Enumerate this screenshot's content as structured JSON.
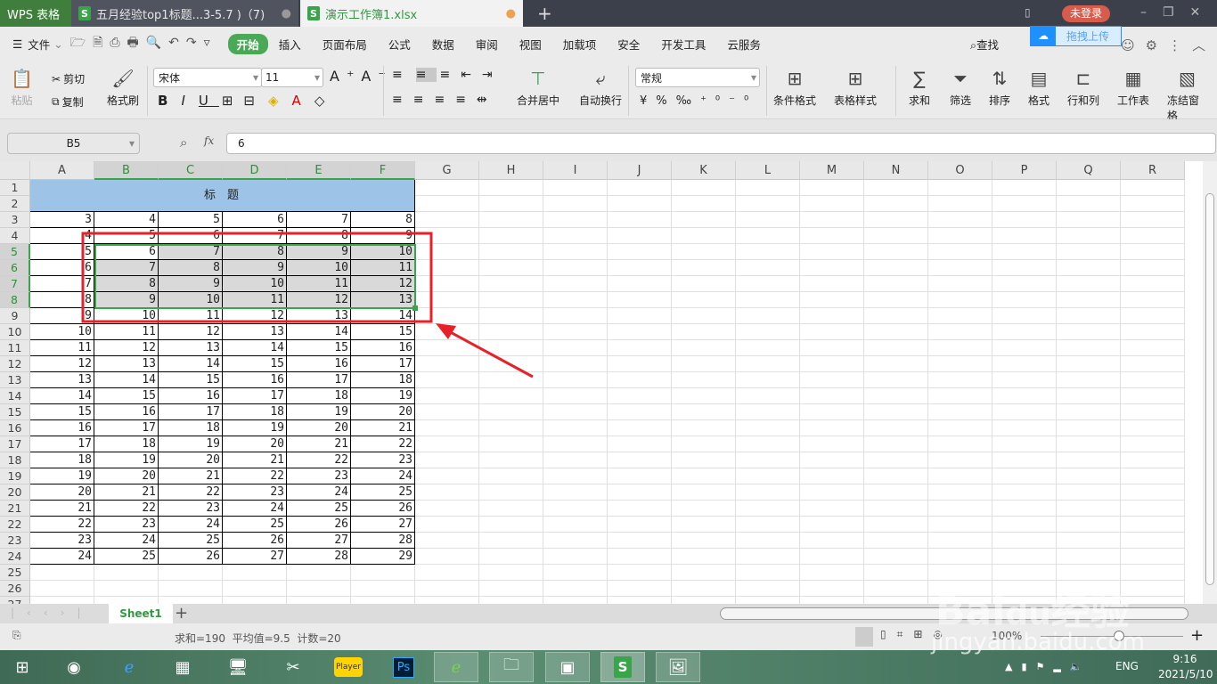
{
  "titlebar": {
    "app_label": "WPS 表格",
    "tabs": [
      {
        "label": "五月经验top1标题...3-5.7 )（7)",
        "active": false
      },
      {
        "label": "演示工作簿1.xlsx",
        "active": true
      }
    ],
    "new_tab": "+",
    "login": "未登录",
    "upload": "拖拽上传"
  },
  "menubar": {
    "file": "文件",
    "items": [
      "开始",
      "插入",
      "页面布局",
      "公式",
      "数据",
      "审阅",
      "视图",
      "加载项",
      "安全",
      "开发工具",
      "云服务"
    ],
    "active": "开始",
    "search": "查找"
  },
  "ribbon": {
    "paste": "粘贴",
    "cut": "剪切",
    "copy": "复制",
    "format_painter": "格式刷",
    "font": "宋体",
    "size": "11",
    "merge": "合并居中",
    "wrap": "自动换行",
    "number_format": "常规",
    "cond_format": "条件格式",
    "table_style": "表格样式",
    "sum": "求和",
    "filter": "筛选",
    "sort": "排序",
    "format": "格式",
    "rowcol": "行和列",
    "sheet": "工作表",
    "freeze": "冻结窗格"
  },
  "formula": {
    "name_box": "B5",
    "fx": "fx",
    "value": "6"
  },
  "grid": {
    "columns": [
      "A",
      "B",
      "C",
      "D",
      "E",
      "F",
      "G",
      "H",
      "I",
      "J",
      "K",
      "L",
      "M",
      "N",
      "O",
      "P",
      "Q",
      "R"
    ],
    "selected_columns": [
      "B",
      "C",
      "D",
      "E",
      "F"
    ],
    "selected_rows": [
      5,
      6,
      7,
      8
    ],
    "row_count": 27,
    "header_text": "标　题",
    "header_color": "#9dc3e6",
    "data": [
      [
        3,
        4,
        5,
        6,
        7,
        8
      ],
      [
        4,
        5,
        6,
        7,
        8,
        9
      ],
      [
        5,
        6,
        7,
        8,
        9,
        10
      ],
      [
        6,
        7,
        8,
        9,
        10,
        11
      ],
      [
        7,
        8,
        9,
        10,
        11,
        12
      ],
      [
        8,
        9,
        10,
        11,
        12,
        13
      ],
      [
        9,
        10,
        11,
        12,
        13,
        14
      ],
      [
        10,
        11,
        12,
        13,
        14,
        15
      ],
      [
        11,
        12,
        13,
        14,
        15,
        16
      ],
      [
        12,
        13,
        14,
        15,
        16,
        17
      ],
      [
        13,
        14,
        15,
        16,
        17,
        18
      ],
      [
        14,
        15,
        16,
        17,
        18,
        19
      ],
      [
        15,
        16,
        17,
        18,
        19,
        20
      ],
      [
        16,
        17,
        18,
        19,
        20,
        21
      ],
      [
        17,
        18,
        19,
        20,
        21,
        22
      ],
      [
        18,
        19,
        20,
        21,
        22,
        23
      ],
      [
        19,
        20,
        21,
        22,
        23,
        24
      ],
      [
        20,
        21,
        22,
        23,
        24,
        25
      ],
      [
        21,
        22,
        23,
        24,
        25,
        26
      ],
      [
        22,
        23,
        24,
        25,
        26,
        27
      ],
      [
        23,
        24,
        25,
        26,
        27,
        28
      ],
      [
        24,
        25,
        26,
        27,
        28,
        29
      ]
    ],
    "data_start_row": 3
  },
  "sheets": {
    "tabs": [
      "Sheet1"
    ],
    "add": "+"
  },
  "status": {
    "summary": "求和=190  平均值=9.5  计数=20",
    "zoom": "100%"
  },
  "annotation_color": "#e8202a",
  "watermark": {
    "text": "jingyan.baidu.com",
    "logo": "Baidu经验"
  },
  "taskbar": {
    "lang": "ENG",
    "time": "9:16",
    "date": "2021/5/10",
    "apps": [
      "windows-start",
      "audio",
      "ie",
      "calculator",
      "monitor",
      "scissors",
      "player",
      "photoshop",
      "360-browser",
      "explorer",
      "control-panel",
      "wps-spreadsheet",
      "photo-viewer"
    ]
  }
}
